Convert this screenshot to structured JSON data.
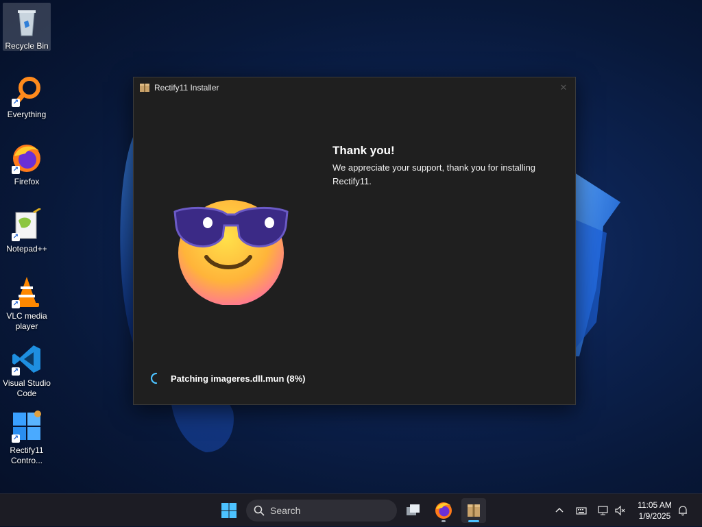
{
  "desktop": {
    "icons": [
      {
        "label": "Recycle Bin",
        "icon": "recycle-bin-icon"
      },
      {
        "label": "Everything",
        "icon": "everything-search-icon"
      },
      {
        "label": "Firefox",
        "icon": "firefox-icon"
      },
      {
        "label": "Notepad++",
        "icon": "notepad-plus-plus-icon"
      },
      {
        "label": "VLC media player",
        "icon": "vlc-icon"
      },
      {
        "label": "Visual Studio Code",
        "icon": "vscode-icon"
      },
      {
        "label": "Rectify11 Contro...",
        "icon": "rectify11-control-panel-icon"
      }
    ]
  },
  "installer": {
    "title": "Rectify11 Installer",
    "heading": "Thank you!",
    "message": "We appreciate your support, thank you for installing Rectify11.",
    "status": "Patching imageres.dll.mun (8%)",
    "progress_percent": 8,
    "close_glyph": "✕"
  },
  "taskbar": {
    "search_placeholder": "Search",
    "clock_time": "11:05 AM",
    "clock_date": "1/9/2025",
    "accent_color": "#4cc2ff",
    "pinned": [
      "start-icon",
      "task-view-icon",
      "firefox-icon",
      "rectify11-installer-icon"
    ]
  }
}
